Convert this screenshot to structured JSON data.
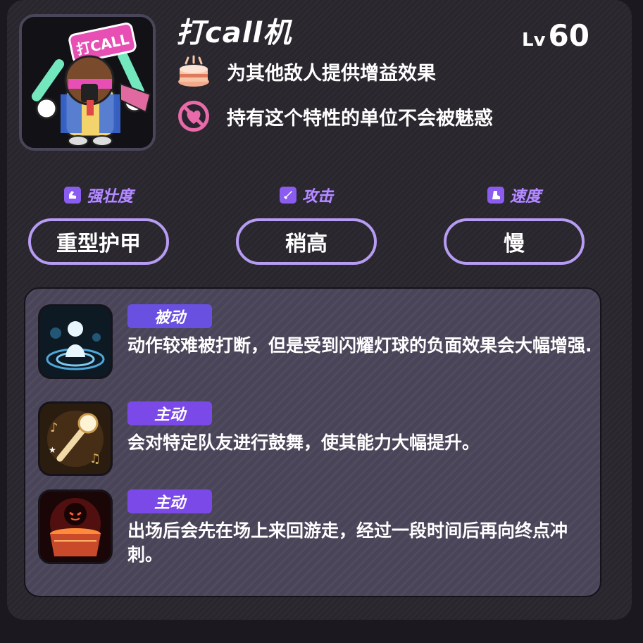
{
  "unit": {
    "name": "打call机",
    "level_prefix": "Lv",
    "level": "60",
    "portrait_sign_text": "打CALL"
  },
  "traits": [
    {
      "icon": "cake-icon",
      "text": "为其他敌人提供增益效果"
    },
    {
      "icon": "no-charm-icon",
      "text": "持有这个特性的单位不会被魅惑"
    }
  ],
  "stats": [
    {
      "icon": "arm-icon",
      "label": "强壮度",
      "value": "重型护甲"
    },
    {
      "icon": "sword-icon",
      "label": "攻击",
      "value": "稍高"
    },
    {
      "icon": "boot-icon",
      "label": "速度",
      "value": "慢"
    }
  ],
  "skills": [
    {
      "icon": "glowing-figure-icon",
      "type": "被动",
      "desc": "动作较难被打断，但是受到闪耀灯球的负面效果会大幅增强."
    },
    {
      "icon": "microphone-icon",
      "type": "主动",
      "desc": "会对特定队友进行鼓舞，使其能力大幅提升。"
    },
    {
      "icon": "demon-cauldron-icon",
      "type": "主动",
      "desc": "出场后会先在场上来回游走，经过一段时间后再向终点冲刺。"
    }
  ],
  "colors": {
    "accent": "#7b49e8",
    "pill_border": "#b69cf2",
    "label": "#b48cff"
  }
}
